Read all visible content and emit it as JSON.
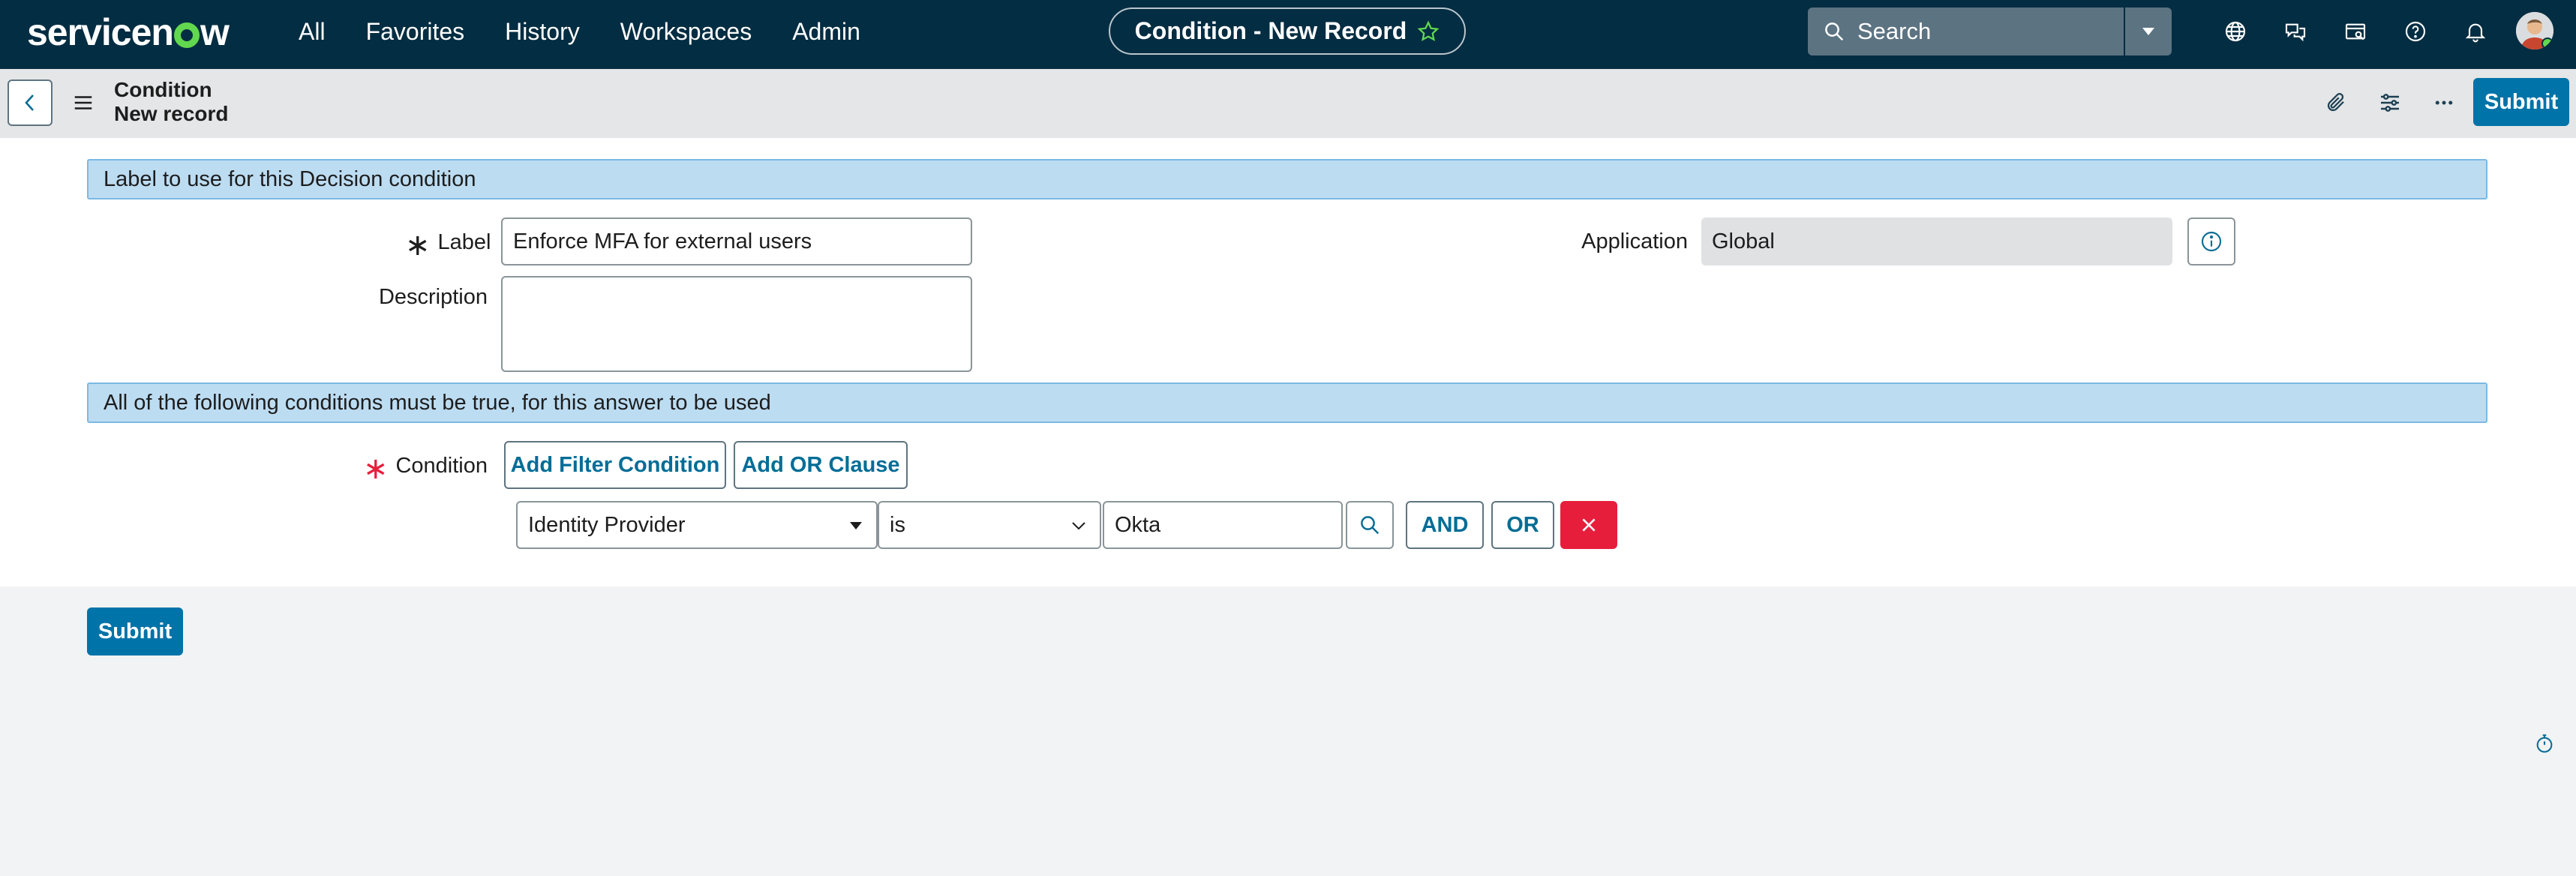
{
  "brand": {
    "logo_text_1": "servicen",
    "logo_text_2": "w"
  },
  "nav": {
    "items": [
      "All",
      "Favorites",
      "History",
      "Workspaces",
      "Admin"
    ]
  },
  "title_pill": {
    "label": "Condition - New Record",
    "icon": "star-icon"
  },
  "search": {
    "placeholder": "Search"
  },
  "nav_icons": [
    "globe-icon",
    "chat-icon",
    "scratchpad-icon",
    "help-icon",
    "bell-icon"
  ],
  "record": {
    "table": "Condition",
    "state": "New record"
  },
  "header_actions": {
    "icons": [
      "attachment-icon",
      "settings-icon",
      "more-icon"
    ],
    "submit_label": "Submit"
  },
  "form": {
    "banner1": "Label to use for this Decision condition",
    "label_field": {
      "label": "Label",
      "value": "Enforce MFA for external users"
    },
    "description_field": {
      "label": "Description",
      "value": ""
    },
    "application_field": {
      "label": "Application",
      "value": "Global"
    },
    "banner2": "All of the following conditions must be true, for this answer to be used",
    "condition": {
      "label": "Condition",
      "add_filter_label": "Add Filter Condition",
      "add_or_label": "Add OR Clause",
      "field": "Identity Provider",
      "operator": "is",
      "value": "Okta",
      "and_label": "AND",
      "or_label": "OR"
    },
    "submit_label": "Submit"
  },
  "colors": {
    "nav_bg": "#032d42",
    "accent": "#0073a8",
    "banner": "#bcdcf2",
    "danger": "#e61e3c",
    "logo_green": "#62d84e"
  }
}
